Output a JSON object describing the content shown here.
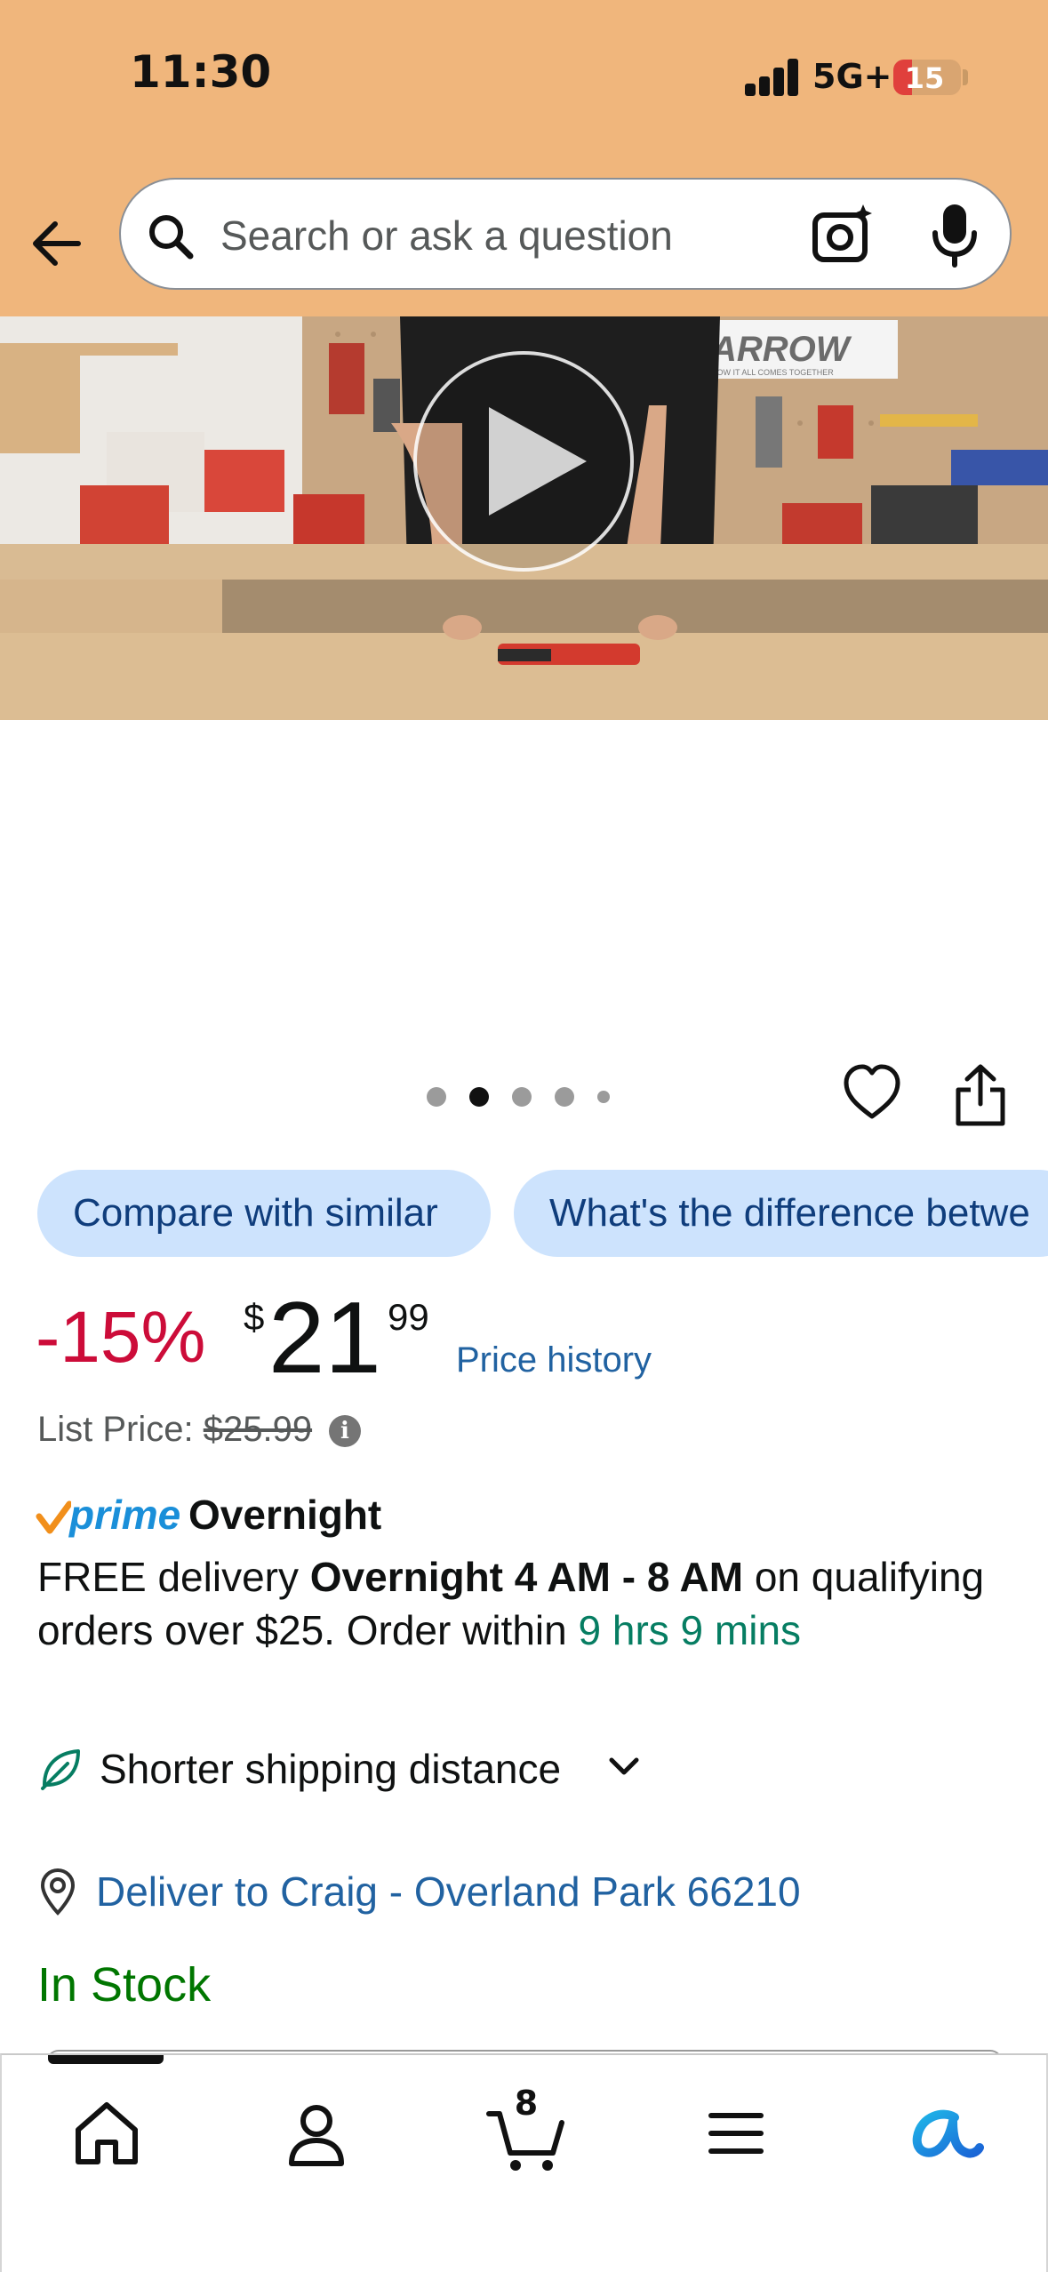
{
  "status_bar": {
    "time": "11:30",
    "network": "5G+",
    "battery_level": "15",
    "battery_fraction": 0.15,
    "battery_color": "#e0403c"
  },
  "search": {
    "placeholder": "Search or ask a question",
    "back_icon": "back-arrow-icon",
    "search_icon": "search-icon",
    "camera_icon": "camera-icon",
    "mic_icon": "microphone-icon"
  },
  "media": {
    "video_logo_text": "ARROW",
    "video_logo_tagline": "HOW IT ALL COMES TOGETHER",
    "play_icon": "play-icon",
    "carousel_count": 5,
    "carousel_active_index": 1
  },
  "actions": {
    "wishlist_icon": "heart-icon",
    "share_icon": "share-icon"
  },
  "chips": [
    {
      "label": "Compare with similar"
    },
    {
      "label": "What's the difference betwe"
    }
  ],
  "price": {
    "discount": "-15%",
    "currency": "$",
    "whole": "21",
    "fraction": "99",
    "history_link": "Price history",
    "list_price_label": "List Price:",
    "list_price_value": "$25.99",
    "info_symbol": "i"
  },
  "delivery": {
    "prime_word": "prime",
    "prime_delivery": "Overnight",
    "line_prefix": "FREE delivery ",
    "window": "Overnight 4 AM - 8 AM",
    "line_middle": " on qualifying orders over $25. Order within ",
    "countdown": "9 hrs 9 mins",
    "eco_label": "Shorter shipping distance",
    "deliver_to": "Deliver to Craig - Overland Park 66210"
  },
  "stock": {
    "status": "In Stock"
  },
  "bottom_nav": {
    "items": [
      "home-icon",
      "account-icon",
      "cart-icon",
      "menu-icon",
      "rufus-ai-icon"
    ],
    "cart_count": "8"
  },
  "colors": {
    "header_bg": "#f0b67c",
    "discount": "#cc0c39",
    "link": "#2162a1",
    "in_stock": "#007600",
    "countdown": "#067d62",
    "chip_bg": "#cde3fd"
  }
}
